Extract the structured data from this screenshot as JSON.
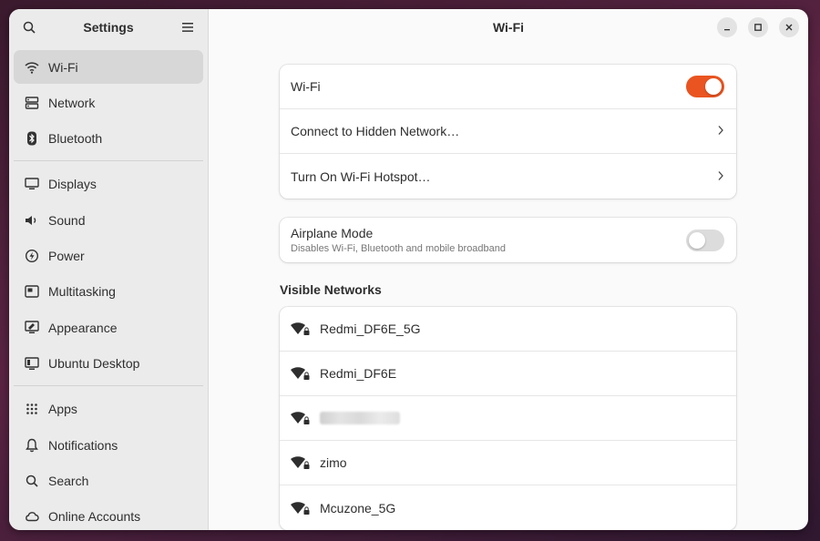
{
  "sidebar": {
    "title": "Settings",
    "items": [
      {
        "label": "Wi-Fi",
        "icon": "wifi-icon",
        "active": true
      },
      {
        "label": "Network",
        "icon": "network-icon"
      },
      {
        "label": "Bluetooth",
        "icon": "bluetooth-icon"
      },
      {
        "label": "Displays",
        "icon": "display-icon"
      },
      {
        "label": "Sound",
        "icon": "speaker-icon"
      },
      {
        "label": "Power",
        "icon": "power-icon"
      },
      {
        "label": "Multitasking",
        "icon": "multitasking-icon"
      },
      {
        "label": "Appearance",
        "icon": "appearance-icon"
      },
      {
        "label": "Ubuntu Desktop",
        "icon": "ubuntu-desktop-icon"
      },
      {
        "label": "Apps",
        "icon": "apps-grid-icon"
      },
      {
        "label": "Notifications",
        "icon": "bell-icon"
      },
      {
        "label": "Search",
        "icon": "search-icon"
      },
      {
        "label": "Online Accounts",
        "icon": "cloud-icon"
      }
    ]
  },
  "header": {
    "title": "Wi-Fi"
  },
  "wifi_card": {
    "wifi_label": "Wi-Fi",
    "wifi_enabled": true,
    "hidden_network_label": "Connect to Hidden Network…",
    "hotspot_label": "Turn On Wi-Fi Hotspot…"
  },
  "airplane": {
    "label": "Airplane Mode",
    "description": "Disables Wi-Fi, Bluetooth and mobile broadband",
    "enabled": false
  },
  "visible_networks": {
    "title": "Visible Networks",
    "networks": [
      {
        "name": "Redmi_DF6E_5G",
        "secured": true
      },
      {
        "name": "Redmi_DF6E",
        "secured": true
      },
      {
        "name": "",
        "secured": true,
        "obscured": true
      },
      {
        "name": "zimo",
        "secured": true
      },
      {
        "name": "Mcuzone_5G",
        "secured": true
      }
    ]
  },
  "colors": {
    "accent": "#e95420",
    "toggle_off": "#dcdcdc",
    "sidebar_bg": "#ebebeb"
  }
}
